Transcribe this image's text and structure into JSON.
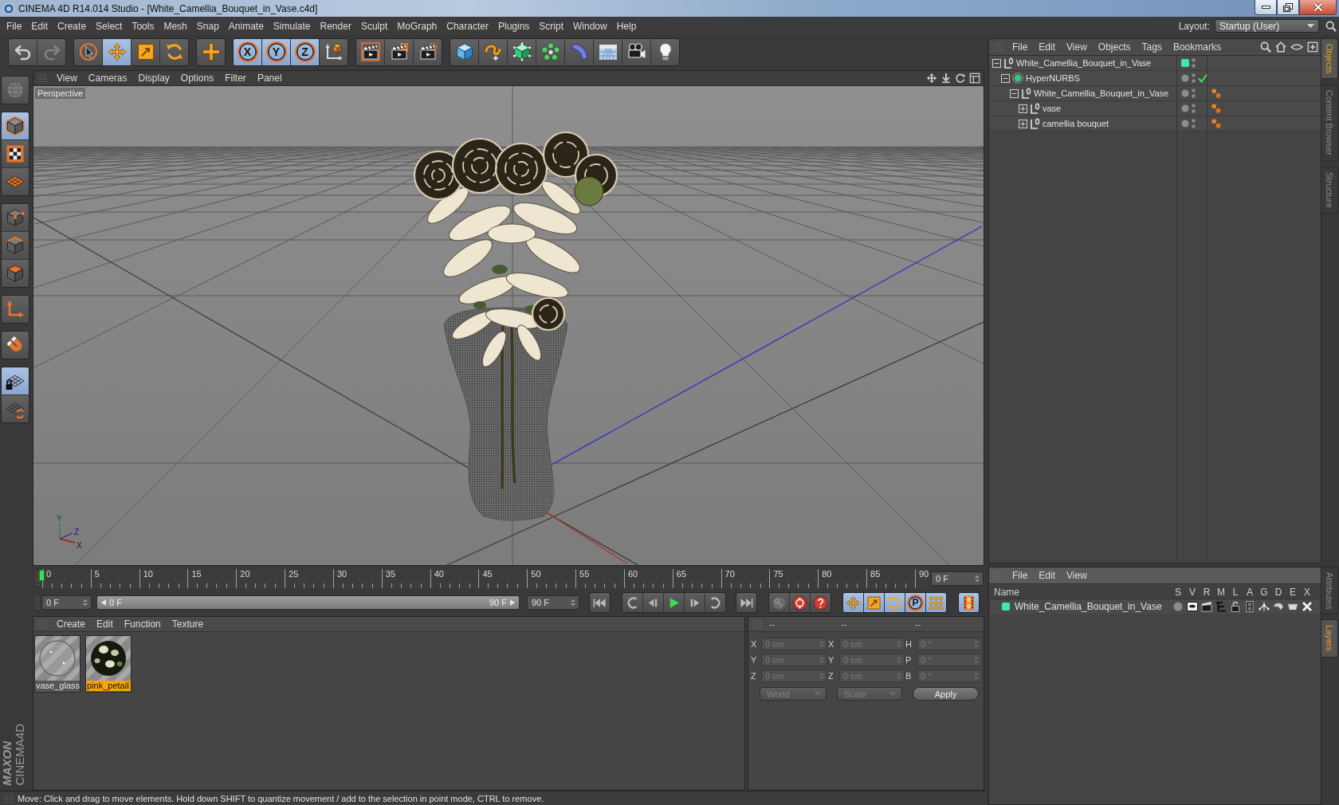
{
  "window": {
    "title": "CINEMA 4D R14.014 Studio - [White_Camellia_Bouquet_in_Vase.c4d]"
  },
  "menu_bar": {
    "items": [
      "File",
      "Edit",
      "Create",
      "Select",
      "Tools",
      "Mesh",
      "Snap",
      "Animate",
      "Simulate",
      "Render",
      "Sculpt",
      "MoGraph",
      "Character",
      "Plugins",
      "Script",
      "Window",
      "Help"
    ],
    "layout_label": "Layout:",
    "layout_value": "Startup (User)"
  },
  "toolbar": {
    "groups": [
      {
        "items": [
          {
            "kind": "undo",
            "selected": false,
            "disabled": false
          },
          {
            "kind": "redo",
            "selected": false,
            "disabled": true
          }
        ]
      },
      {
        "items": [
          {
            "kind": "live-select",
            "selected": false,
            "disabled": false
          },
          {
            "kind": "move",
            "selected": true,
            "disabled": false
          },
          {
            "kind": "scale",
            "selected": false,
            "disabled": false
          },
          {
            "kind": "rotate",
            "selected": false,
            "disabled": false
          }
        ]
      },
      {
        "items": [
          {
            "kind": "add",
            "selected": false,
            "disabled": false
          }
        ]
      },
      {
        "items": [
          {
            "kind": "axis-lock",
            "label": "X",
            "selected": true,
            "disabled": false
          },
          {
            "kind": "axis-lock",
            "label": "Y",
            "selected": true,
            "disabled": false
          },
          {
            "kind": "axis-lock",
            "label": "Z",
            "selected": true,
            "disabled": false
          },
          {
            "kind": "coordinate-system",
            "selected": false,
            "disabled": false
          }
        ]
      },
      {
        "items": [
          {
            "kind": "render-view",
            "selected": false,
            "disabled": false
          },
          {
            "kind": "render-picture",
            "selected": false,
            "disabled": false
          },
          {
            "kind": "render-settings",
            "selected": false,
            "disabled": false
          }
        ]
      },
      {
        "items": [
          {
            "kind": "cube",
            "selected": false,
            "disabled": false
          },
          {
            "kind": "spline",
            "selected": false,
            "disabled": false
          },
          {
            "kind": "nurbs",
            "selected": false,
            "disabled": false
          },
          {
            "kind": "array",
            "selected": false,
            "disabled": false
          },
          {
            "kind": "deformer",
            "selected": false,
            "disabled": false
          },
          {
            "kind": "floor",
            "selected": false,
            "disabled": false
          },
          {
            "kind": "camera",
            "selected": false,
            "disabled": false
          },
          {
            "kind": "light",
            "selected": false,
            "disabled": false
          }
        ]
      }
    ]
  },
  "left_toolbar": {
    "groups": [
      {
        "items": [
          {
            "kind": "make-editable",
            "selected": false
          }
        ]
      },
      {
        "items": [
          {
            "kind": "model",
            "selected": true
          },
          {
            "kind": "texture",
            "selected": false
          },
          {
            "kind": "workplane",
            "selected": false
          }
        ]
      },
      {
        "items": [
          {
            "kind": "points",
            "selected": false
          },
          {
            "kind": "edges",
            "selected": false
          },
          {
            "kind": "polygons",
            "selected": false
          }
        ]
      },
      {
        "items": [
          {
            "kind": "axis",
            "selected": false
          }
        ]
      },
      {
        "items": [
          {
            "kind": "snap",
            "selected": false
          }
        ]
      },
      {
        "items": [
          {
            "kind": "workplane-lock",
            "selected": true
          },
          {
            "kind": "workplane-grid",
            "selected": false
          }
        ]
      }
    ]
  },
  "logo": {
    "brand": "MAXON",
    "product": "CINEMA4D"
  },
  "viewport": {
    "menu": [
      "View",
      "Cameras",
      "Display",
      "Options",
      "Filter",
      "Panel"
    ],
    "camera": "Perspective",
    "axis_labels": [
      "Y",
      "Z",
      "X"
    ]
  },
  "timeline": {
    "ticks": [
      "0",
      "5",
      "10",
      "15",
      "20",
      "25",
      "30",
      "35",
      "40",
      "45",
      "50",
      "55",
      "60",
      "65",
      "70",
      "75",
      "80",
      "85",
      "90"
    ],
    "level": 0,
    "frame": "0 F"
  },
  "transport": {
    "start": "0 F",
    "range": {
      "start_label": "0 F",
      "end_label": "90 F",
      "level": 1
    },
    "end": "90 F",
    "groups": [
      {
        "items": [
          {
            "kind": "go-start",
            "selected": false
          }
        ]
      },
      {
        "items": [
          {
            "kind": "prev-key",
            "selected": false
          },
          {
            "kind": "prev-frame",
            "selected": false
          },
          {
            "kind": "play",
            "selected": false
          },
          {
            "kind": "next-frame",
            "selected": false
          },
          {
            "kind": "next-key",
            "selected": false
          }
        ]
      },
      {
        "items": [
          {
            "kind": "go-end",
            "selected": false
          }
        ]
      },
      {
        "items": [
          {
            "kind": "record",
            "selected": false
          },
          {
            "kind": "auto-key",
            "selected": false
          },
          {
            "kind": "key-help",
            "selected": false
          }
        ]
      },
      {
        "items": [
          {
            "kind": "move",
            "selected": true
          },
          {
            "kind": "scale",
            "selected": true
          },
          {
            "kind": "rotate",
            "selected": true
          },
          {
            "kind": "parameter",
            "label": "P",
            "selected": true
          },
          {
            "kind": "point-level",
            "selected": true
          }
        ]
      },
      {
        "items": [
          {
            "kind": "timeline",
            "selected": true
          }
        ]
      }
    ]
  },
  "materials": {
    "menu": [
      "Create",
      "Edit",
      "Function",
      "Texture"
    ],
    "items": [
      {
        "name": "vase_glass",
        "kind": "glass",
        "selected": false
      },
      {
        "name": "pink_petail",
        "kind": "petal",
        "selected": true
      }
    ]
  },
  "coordinates": {
    "headers": [
      "--",
      "--",
      "--"
    ],
    "disabled": true,
    "rows": [
      {
        "position_axis": "X",
        "position": "0 cm",
        "size_axis": "X",
        "size": "0 cm",
        "rotation_axis": "H",
        "rotation": "0 °"
      },
      {
        "position_axis": "Y",
        "position": "0 cm",
        "size_axis": "Y",
        "size": "0 cm",
        "rotation_axis": "P",
        "rotation": "0 °"
      },
      {
        "position_axis": "Z",
        "position": "0 cm",
        "size_axis": "Z",
        "size": "0 cm",
        "rotation_axis": "B",
        "rotation": "0 °"
      }
    ],
    "position_mode": "World",
    "size_mode": "Scale",
    "apply": "Apply"
  },
  "status_bar": {
    "text": "Move: Click and drag to move elements. Hold down SHIFT to quantize movement / add to the selection in point mode, CTRL to remove."
  },
  "object_manager": {
    "menu": [
      "File",
      "Edit",
      "View",
      "Objects",
      "Tags",
      "Bookmarks"
    ],
    "tree": [
      {
        "name": "White_Camellia_Bouquet_in_Vase",
        "kind": "null",
        "expanded": true,
        "color": "#3fe6b2",
        "checked": false,
        "material_tag": false,
        "children": [
          {
            "name": "HyperNURBS",
            "kind": "hypernurbs",
            "expanded": true,
            "checked": true,
            "material_tag": false,
            "children": [
              {
                "name": "White_Camellia_Bouquet_in_Vase",
                "kind": "null",
                "expanded": true,
                "checked": false,
                "material_tag": true,
                "children": [
                  {
                    "name": "vase",
                    "kind": "null",
                    "expanded": false,
                    "checked": false,
                    "material_tag": true
                  },
                  {
                    "name": "camellia bouquet",
                    "kind": "null",
                    "expanded": false,
                    "checked": false,
                    "material_tag": true
                  }
                ]
              }
            ]
          }
        ]
      }
    ]
  },
  "layers": {
    "menu": [
      "File",
      "Edit",
      "View"
    ],
    "columns": [
      "Name",
      "S",
      "V",
      "R",
      "M",
      "L",
      "A",
      "G",
      "D",
      "E",
      "X"
    ],
    "rows": [
      {
        "name": "White_Camellia_Bouquet_in_Vase",
        "color": "#3fe6b2"
      }
    ]
  },
  "side_tabs": {
    "top": [
      {
        "label": "Objects",
        "selected": true
      },
      {
        "label": "Content Browser",
        "selected": false
      },
      {
        "label": "Structure",
        "selected": false
      }
    ],
    "bottom": [
      {
        "label": "Attributes",
        "selected": false
      },
      {
        "label": "Layers",
        "selected": true
      }
    ]
  }
}
